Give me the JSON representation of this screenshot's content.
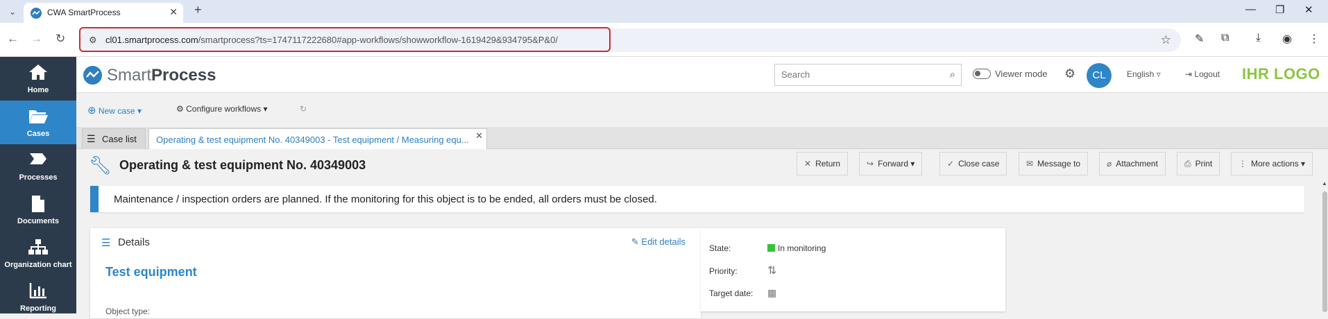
{
  "browser": {
    "tab_title": "CWA SmartProcess",
    "new_tab": "+",
    "url_host": "cl01.smartprocess.com",
    "url_path": "/smartprocess?ts=1747117222680#app-workflows/showworkflow-1619429&934795&P&0/"
  },
  "sidebar": {
    "items": [
      {
        "label": "Home",
        "icon": "home-icon"
      },
      {
        "label": "Cases",
        "icon": "folder-icon"
      },
      {
        "label": "Processes",
        "icon": "process-icon"
      },
      {
        "label": "Documents",
        "icon": "document-icon"
      },
      {
        "label": "Organization chart",
        "icon": "org-chart-icon"
      },
      {
        "label": "Reporting",
        "icon": "chart-icon"
      }
    ]
  },
  "header": {
    "logo_light": "Smart",
    "logo_bold": "Process",
    "search_placeholder": "Search",
    "viewer_mode": "Viewer mode",
    "avatar_initials": "CL",
    "language": "English",
    "logout": "Logout",
    "brand": "IHR LOGO"
  },
  "toolbar": {
    "new_case": "New case",
    "configure_workflows": "Configure workflows"
  },
  "tabs": {
    "case_list": "Case list",
    "active_case": "Operating & test equipment No. 40349003 - Test equipment / Measuring equ..."
  },
  "case": {
    "title": "Operating & test equipment No. 40349003",
    "actions": {
      "return": "Return",
      "forward": "Forward",
      "close_case": "Close case",
      "message_to": "Message to",
      "attachment": "Attachment",
      "print": "Print",
      "more_actions": "More actions"
    },
    "notice": "Maintenance / inspection orders are planned. If the monitoring for this object is to be ended, all orders must be closed.",
    "details": {
      "heading": "Details",
      "edit_label": "Edit details",
      "object_title": "Test equipment",
      "object_type_label": "Object type:"
    },
    "status": {
      "state_label": "State:",
      "state_value": "In monitoring",
      "state_color": "#35c436",
      "priority_label": "Priority:",
      "target_date_label": "Target date:"
    }
  },
  "colors": {
    "accent": "#2e86c9",
    "sidebar_bg": "#2c3b4c",
    "brand_green": "#8bc53f",
    "highlight_red": "#d0282d"
  }
}
